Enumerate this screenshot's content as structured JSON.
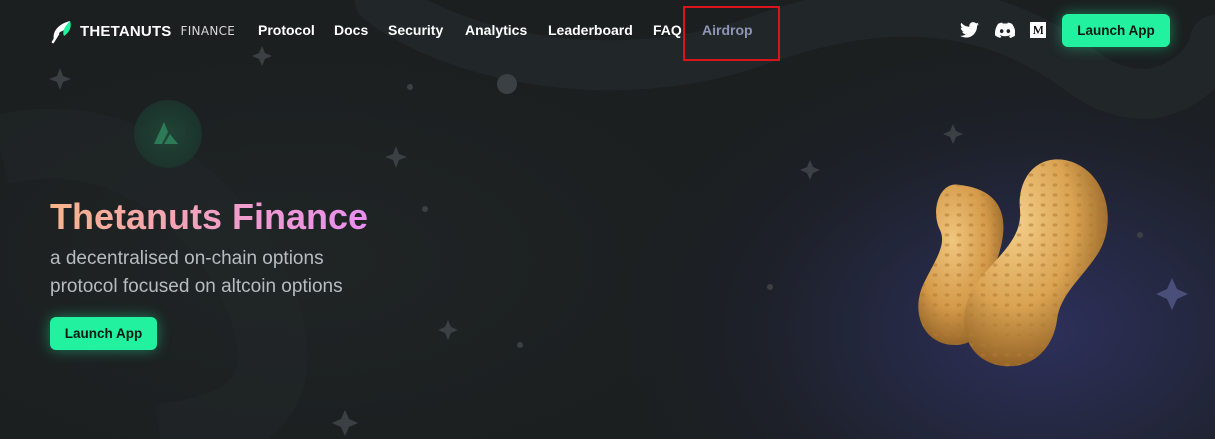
{
  "brand": {
    "name_bold": "THETANUTS",
    "name_light": "FINANCE"
  },
  "nav": {
    "links": [
      {
        "label": "Protocol"
      },
      {
        "label": "Docs"
      },
      {
        "label": "Security"
      },
      {
        "label": "Analytics"
      },
      {
        "label": "Leaderboard"
      },
      {
        "label": "FAQ"
      },
      {
        "label": "Airdrop"
      }
    ],
    "social_icons": [
      "twitter-icon",
      "discord-icon",
      "medium-icon"
    ],
    "cta_label": "Launch App"
  },
  "hero": {
    "title": "Thetanuts Finance",
    "subtitle_line1": "a decentralised on-chain options",
    "subtitle_line2": "protocol focused on altcoin options",
    "cta_label": "Launch App"
  },
  "colors": {
    "accent": "#22f29f",
    "background": "#1b1f20",
    "highlight_border": "#d9141b",
    "airdrop_link": "#8f95b4"
  }
}
